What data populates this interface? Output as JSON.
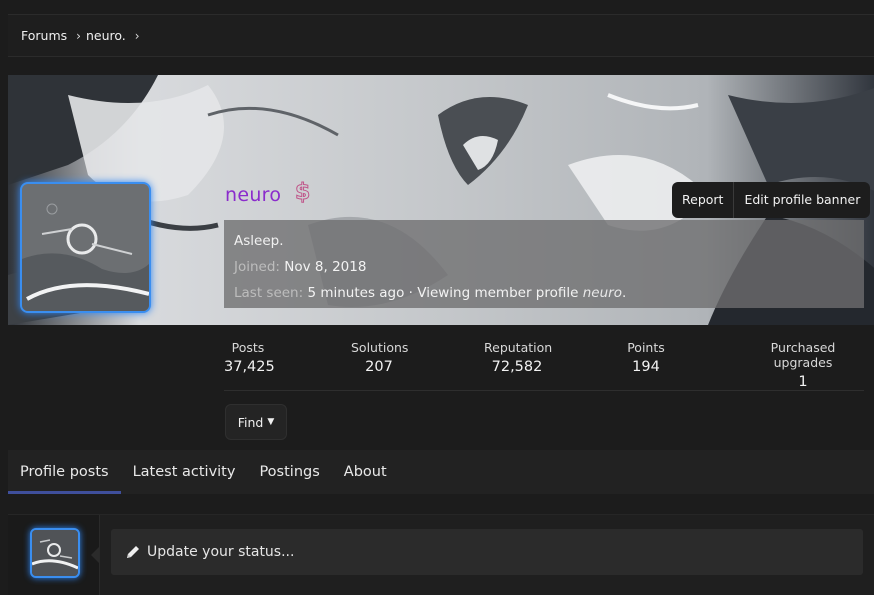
{
  "breadcrumb": {
    "items": [
      "Forums",
      "neuro."
    ]
  },
  "profile": {
    "username": "neuro",
    "badge_icon": "dollar-sign-icon",
    "status": "Asleep.",
    "joined_label": "Joined:",
    "joined_value": "Nov 8, 2018",
    "last_seen_label": "Last seen:",
    "last_seen_value": "5 minutes ago · Viewing member profile",
    "last_seen_target": "neuro",
    "last_seen_end": "."
  },
  "banner_actions": {
    "report": "Report",
    "edit_banner": "Edit profile banner"
  },
  "stats": [
    {
      "label": "Posts",
      "value": "37,425"
    },
    {
      "label": "Solutions",
      "value": "207"
    },
    {
      "label": "Reputation",
      "value": "72,582"
    },
    {
      "label": "Points",
      "value": "194"
    },
    {
      "label": "Purchased upgrades",
      "value": "1"
    }
  ],
  "find_button": {
    "label": "Find",
    "icon": "caret-down-icon"
  },
  "tabs": [
    "Profile posts",
    "Latest activity",
    "Postings",
    "About"
  ],
  "active_tab": "Profile posts",
  "composer": {
    "placeholder": "Update your status...",
    "icon": "pencil-icon"
  },
  "colors": {
    "username": "#8b2bcc",
    "avatar_border": "#3a8ef0",
    "tab_underline": "#3f4f9c",
    "page_bg": "#1c1c1c"
  }
}
